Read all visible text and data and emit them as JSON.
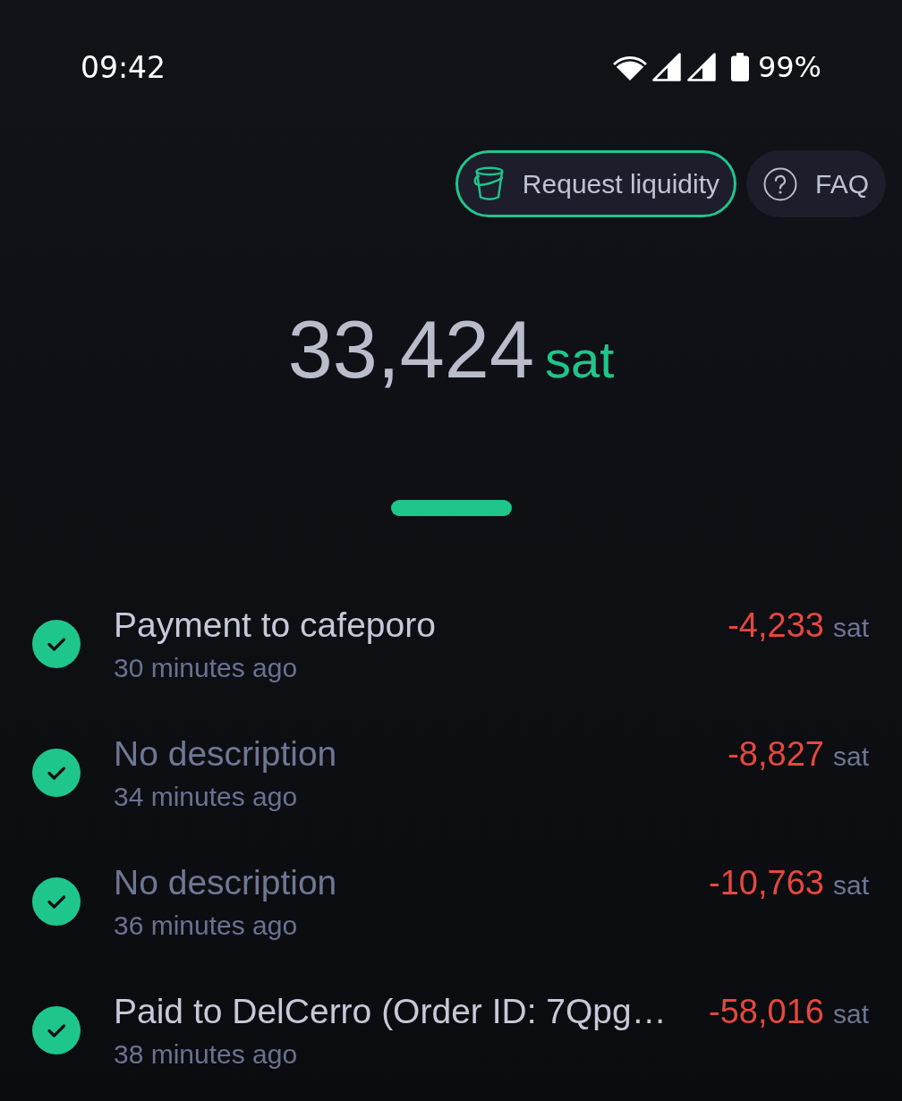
{
  "status_bar": {
    "time": "09:42",
    "battery": "99%"
  },
  "header_buttons": [
    {
      "kind": "liquidity",
      "label": "Request liquidity",
      "highlighted": true
    },
    {
      "kind": "faq",
      "label": "FAQ",
      "highlighted": false
    }
  ],
  "balance": {
    "amount": "33,424",
    "unit": "sat"
  },
  "transactions": [
    {
      "completed": true,
      "title": "Payment to cafeporo",
      "has_description": true,
      "time": "30 minutes ago",
      "amount": "-4,233",
      "outgoing": true,
      "unit": "sat"
    },
    {
      "completed": true,
      "title": "No description",
      "has_description": false,
      "time": "34 minutes ago",
      "amount": "-8,827",
      "outgoing": true,
      "unit": "sat"
    },
    {
      "completed": true,
      "title": "No description",
      "has_description": false,
      "time": "36 minutes ago",
      "amount": "-10,763",
      "outgoing": true,
      "unit": "sat"
    },
    {
      "completed": true,
      "title": "Paid to DelCerro (Order ID: 7Qpg…",
      "has_description": true,
      "time": "38 minutes ago",
      "amount": "-58,016",
      "outgoing": true,
      "unit": "sat"
    }
  ]
}
